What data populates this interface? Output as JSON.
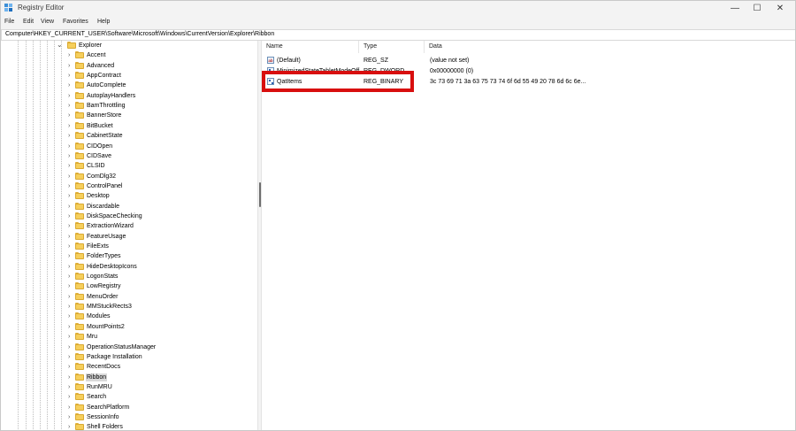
{
  "window": {
    "title": "Registry Editor",
    "minimize_glyph": "—",
    "maximize_glyph": "☐",
    "close_glyph": "✕"
  },
  "menu": [
    "File",
    "Edit",
    "View",
    "Favorites",
    "Help"
  ],
  "address": "Computer\\HKEY_CURRENT_USER\\Software\\Microsoft\\Windows\\CurrentVersion\\Explorer\\Ribbon",
  "tree": {
    "parent": "Explorer",
    "children": [
      "Accent",
      "Advanced",
      "AppContract",
      "AutoComplete",
      "AutoplayHandlers",
      "BamThrottling",
      "BannerStore",
      "BitBucket",
      "CabinetState",
      "CIDOpen",
      "CIDSave",
      "CLSID",
      "ComDlg32",
      "ControlPanel",
      "Desktop",
      "Discardable",
      "DiskSpaceChecking",
      "ExtractionWizard",
      "FeatureUsage",
      "FileExts",
      "FolderTypes",
      "HideDesktopIcons",
      "LogonStats",
      "LowRegistry",
      "MenuOrder",
      "MMStuckRects3",
      "Modules",
      "MountPoints2",
      "Mru",
      "OperationStatusManager",
      "Package Installation",
      "RecentDocs",
      "Ribbon",
      "RunMRU",
      "Search",
      "SearchPlatform",
      "SessionInfo",
      "Shell Folders"
    ],
    "selected": "Ribbon"
  },
  "values_table": {
    "headers": {
      "name": "Name",
      "type": "Type",
      "data": "Data"
    },
    "rows": [
      {
        "name": "(Default)",
        "type": "REG_SZ",
        "data": "(value not set)",
        "icon": "string-value-icon"
      },
      {
        "name": "MinimizedStateTabletModeOff",
        "type": "REG_DWORD",
        "data": "0x00000000 (0)",
        "icon": "binary-value-icon"
      },
      {
        "name": "QatItems",
        "type": "REG_BINARY",
        "data": "3c 73 69 71 3a 63 75 73 74 6f 6d 55 49 20 78 6d 6c 6e...",
        "icon": "binary-value-icon"
      }
    ]
  },
  "annotation": {
    "color": "#d80f0f"
  }
}
